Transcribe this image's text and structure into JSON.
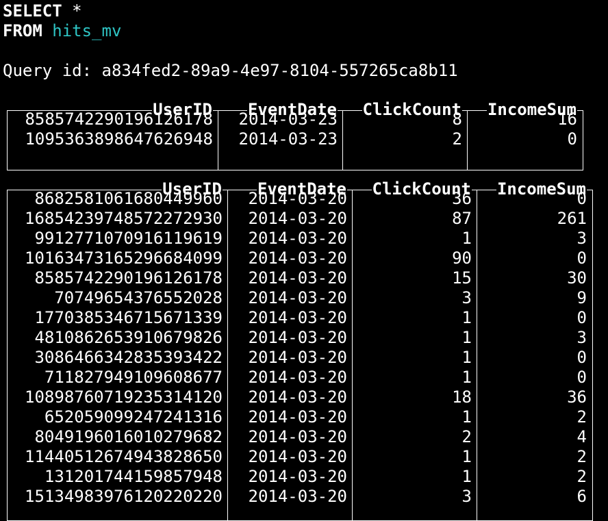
{
  "query": {
    "select_keyword": "SELECT",
    "select_star": " *",
    "from_keyword": "FROM",
    "from_table": "hits_mv",
    "query_id_label": "Query id:",
    "query_id": "a834fed2-89a9-4e97-8104-557265ca8b11"
  },
  "colors": {
    "background": "#000000",
    "text": "#ffffff",
    "identifier": "#2ec4c4"
  },
  "result_blocks": [
    {
      "columns": [
        "UserID",
        "EventDate",
        "ClickCount",
        "IncomeSum"
      ],
      "rows": [
        [
          "8585742290196126178",
          "2014-03-23",
          "8",
          "16"
        ],
        [
          "1095363898647626948",
          "2014-03-23",
          "2",
          "0"
        ]
      ]
    },
    {
      "columns": [
        "UserID",
        "EventDate",
        "ClickCount",
        "IncomeSum"
      ],
      "rows": [
        [
          "8682581061680449960",
          "2014-03-20",
          "36",
          "0"
        ],
        [
          "16854239748572272930",
          "2014-03-20",
          "87",
          "261"
        ],
        [
          "9912771070916119619",
          "2014-03-20",
          "1",
          "3"
        ],
        [
          "10163473165296684099",
          "2014-03-20",
          "90",
          "0"
        ],
        [
          "8585742290196126178",
          "2014-03-20",
          "15",
          "30"
        ],
        [
          "70749654376552028",
          "2014-03-20",
          "3",
          "9"
        ],
        [
          "1770385346715671339",
          "2014-03-20",
          "1",
          "0"
        ],
        [
          "4810862653910679826",
          "2014-03-20",
          "1",
          "3"
        ],
        [
          "3086466342835393422",
          "2014-03-20",
          "1",
          "0"
        ],
        [
          "711827949109608677",
          "2014-03-20",
          "1",
          "0"
        ],
        [
          "10898760719235314120",
          "2014-03-20",
          "18",
          "36"
        ],
        [
          "652059099247241316",
          "2014-03-20",
          "1",
          "2"
        ],
        [
          "8049196016010279682",
          "2014-03-20",
          "2",
          "4"
        ],
        [
          "11440512674943828650",
          "2014-03-20",
          "1",
          "2"
        ],
        [
          "131201744159857948",
          "2014-03-20",
          "1",
          "2"
        ],
        [
          "15134983976120220220",
          "2014-03-20",
          "3",
          "6"
        ]
      ]
    }
  ]
}
